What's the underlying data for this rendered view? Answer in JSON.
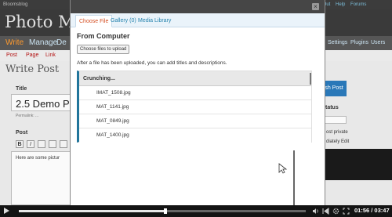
{
  "background": {
    "topbar_left": "Bloomsblog",
    "topbar_right": [
      "Log Out",
      "Help",
      "Forums"
    ],
    "site_title": "Photo Math",
    "nav": [
      "Write",
      "Manage",
      "De"
    ],
    "nav_right": [
      "Settings",
      "Plugins",
      "Users"
    ],
    "subnav": [
      "Post",
      "Page",
      "Link"
    ],
    "page_heading": "Write Post",
    "title_label": "Title",
    "post_title": "2.5 Demo Po",
    "permalink": "Permalink: ...",
    "post_label": "Post",
    "editor_buttons": [
      "B",
      "I",
      "",
      "",
      ""
    ],
    "content_text": "Here are some pictur",
    "publish_label": "sh Post",
    "status_label": "tatus",
    "side_lines": [
      "ost private",
      "diately Edit"
    ]
  },
  "modal": {
    "tabs": [
      {
        "label": "Choose File",
        "active": true
      },
      {
        "label": "Gallery (0)",
        "active": false
      },
      {
        "label": "Media Library",
        "active": false
      }
    ],
    "close_icon": "×",
    "section_title": "From Computer",
    "upload_button": "Choose files to upload",
    "hint": "After a file has been uploaded, you can add titles and descriptions.",
    "crunching": "Crunching...",
    "files": [
      "IMAT_1508.jpg",
      "MAT_1141.jpg",
      "MAT_0849.jpg",
      "MAT_1400.jpg"
    ]
  },
  "video": {
    "time": "01:56 / 03:47",
    "progress": 0.51
  },
  "colors": {
    "accent": "#21759b",
    "active_tab": "#d54e21",
    "link": "#2583ad"
  }
}
